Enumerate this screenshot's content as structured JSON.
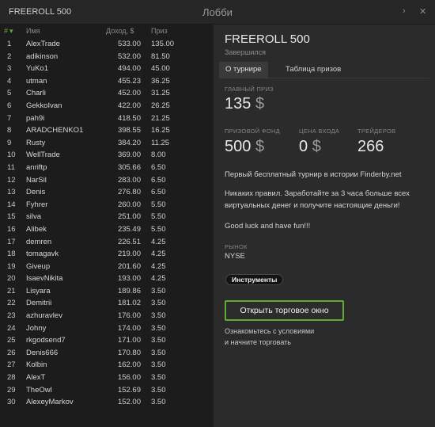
{
  "app_title": "FREEROLL 500",
  "window_title": "Лобби",
  "window_controls": {
    "prev": "›",
    "close": "✕"
  },
  "table": {
    "sort_icon": "#",
    "headers": {
      "name": "Имя",
      "income": "Доход, $",
      "prize": "Приз"
    },
    "rows": [
      {
        "rank": "1",
        "name": "AlexTrade",
        "income": "533.00",
        "prize": "135.00"
      },
      {
        "rank": "2",
        "name": "adikinson",
        "income": "532.00",
        "prize": "81.50"
      },
      {
        "rank": "3",
        "name": "YuKo1",
        "income": "494.00",
        "prize": "45.00"
      },
      {
        "rank": "4",
        "name": "utman",
        "income": "455.23",
        "prize": "36.25"
      },
      {
        "rank": "5",
        "name": "Charli",
        "income": "452.00",
        "prize": "31.25"
      },
      {
        "rank": "6",
        "name": "GekkoIvan",
        "income": "422.00",
        "prize": "26.25"
      },
      {
        "rank": "7",
        "name": "pah9i",
        "income": "418.50",
        "prize": "21.25"
      },
      {
        "rank": "8",
        "name": "ARADCHENKO1",
        "income": "398.55",
        "prize": "16.25"
      },
      {
        "rank": "9",
        "name": "Rusty",
        "income": "384.20",
        "prize": "11.25"
      },
      {
        "rank": "10",
        "name": "WellTrade",
        "income": "369.00",
        "prize": "8.00"
      },
      {
        "rank": "11",
        "name": "anriftp",
        "income": "305.66",
        "prize": "6.50"
      },
      {
        "rank": "12",
        "name": "NarSil",
        "income": "283.00",
        "prize": "6.50"
      },
      {
        "rank": "13",
        "name": "Denis",
        "income": "276.80",
        "prize": "6.50"
      },
      {
        "rank": "14",
        "name": "Fyhrer",
        "income": "260.00",
        "prize": "5.50"
      },
      {
        "rank": "15",
        "name": "silva",
        "income": "251.00",
        "prize": "5.50"
      },
      {
        "rank": "16",
        "name": "Alibek",
        "income": "235.49",
        "prize": "5.50"
      },
      {
        "rank": "17",
        "name": "demren",
        "income": "226.51",
        "prize": "4.25"
      },
      {
        "rank": "18",
        "name": "tomagavk",
        "income": "219.00",
        "prize": "4.25"
      },
      {
        "rank": "19",
        "name": "Giveup",
        "income": "201.60",
        "prize": "4.25"
      },
      {
        "rank": "20",
        "name": "IsaevNikita",
        "income": "193.00",
        "prize": "4.25"
      },
      {
        "rank": "21",
        "name": "Lisyara",
        "income": "189.86",
        "prize": "3.50"
      },
      {
        "rank": "22",
        "name": "Demitrii",
        "income": "181.02",
        "prize": "3.50"
      },
      {
        "rank": "23",
        "name": "azhuravlev",
        "income": "176.00",
        "prize": "3.50"
      },
      {
        "rank": "24",
        "name": "Johny",
        "income": "174.00",
        "prize": "3.50"
      },
      {
        "rank": "25",
        "name": "rkgodsend7",
        "income": "171.00",
        "prize": "3.50"
      },
      {
        "rank": "26",
        "name": "Denis666",
        "income": "170.80",
        "prize": "3.50"
      },
      {
        "rank": "27",
        "name": "Kolbin",
        "income": "162.00",
        "prize": "3.50"
      },
      {
        "rank": "28",
        "name": "AlexT",
        "income": "156.00",
        "prize": "3.50"
      },
      {
        "rank": "29",
        "name": "TheOwl",
        "income": "152.69",
        "prize": "3.50"
      },
      {
        "rank": "30",
        "name": "AlexeyMarkov",
        "income": "152.00",
        "prize": "3.50"
      }
    ]
  },
  "details": {
    "title": "FREEROLL 500",
    "status": "Завершился",
    "tabs": [
      "О турнире",
      "Таблица призов"
    ],
    "main_prize_label": "ГЛАВНЫЙ ПРИЗ",
    "main_prize_value": "135",
    "currency": "$",
    "prize_fund_label": "ПРИЗОВОЙ ФОНД",
    "prize_fund_value": "500",
    "entry_label": "ЦЕНА ВХОДА",
    "entry_value": "0",
    "traders_label": "ТРЕЙДЕРОВ",
    "traders_value": "266",
    "description1": "Первый бесплатный турнир в истории Finderby.net",
    "description2": "Никаких правил. Заработайте за 3 часа больше всех виртуальных денег и получите настоящие деньги!",
    "description3": "Good luck and have fun!!!",
    "market_label": "РЫНОК",
    "market_value": "NYSE",
    "tools_button": "Инструменты",
    "open_button": "Открыть торговое окно",
    "note_line1": "Ознакомьтесь с условиями",
    "note_line2": "и начните торговать"
  },
  "colors": {
    "accent": "#62a838",
    "panel": "#2b2b2b",
    "background": "#1c1c1c"
  }
}
